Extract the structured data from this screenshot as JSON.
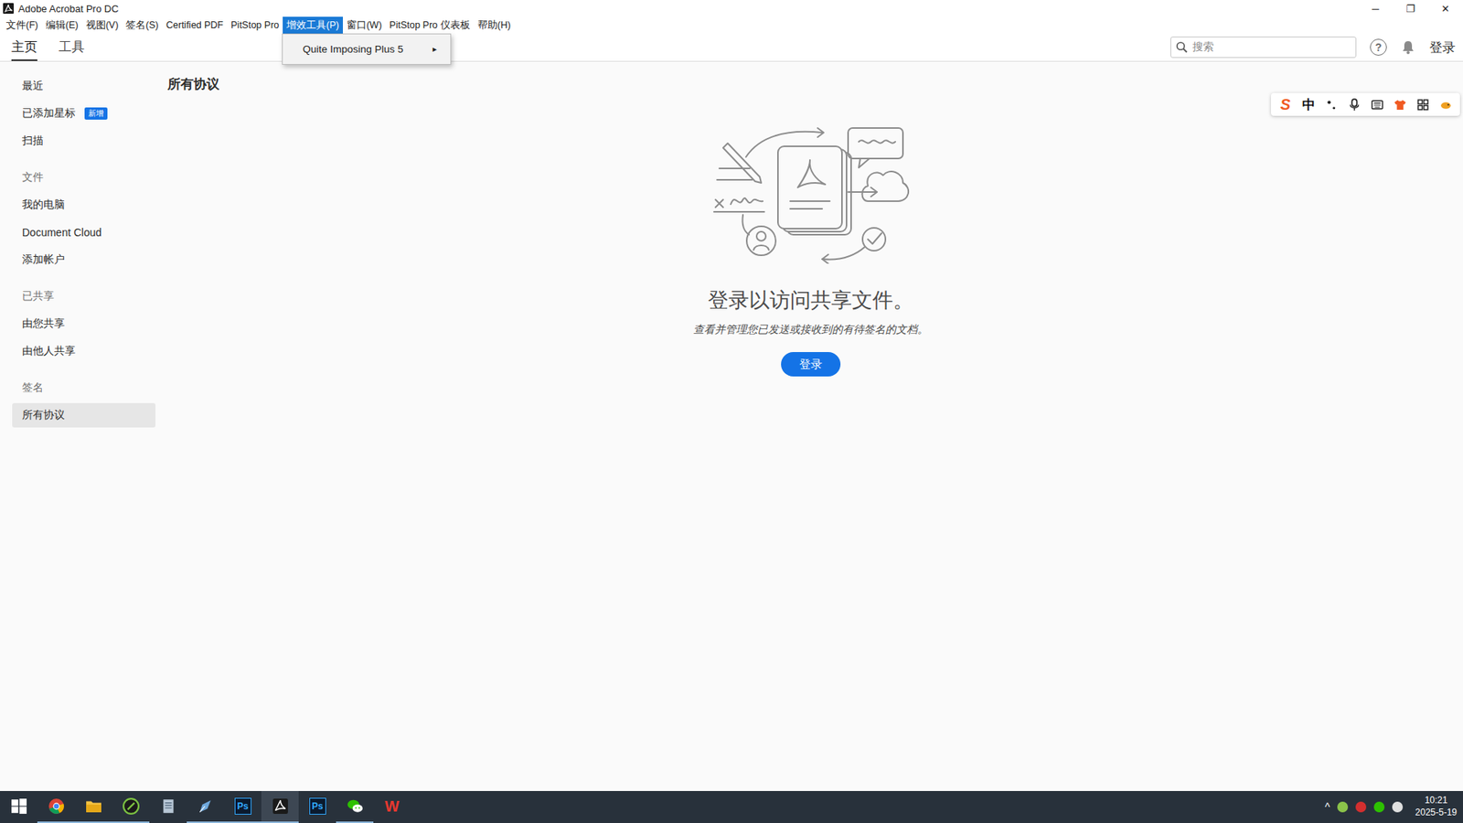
{
  "window": {
    "title": "Adobe Acrobat Pro DC",
    "controls": [
      "─",
      "❐",
      "✕"
    ]
  },
  "menubar": [
    {
      "label": "文件(F)",
      "selected": false
    },
    {
      "label": "编辑(E)",
      "selected": false
    },
    {
      "label": "视图(V)",
      "selected": false
    },
    {
      "label": "签名(S)",
      "selected": false
    },
    {
      "label": "Certified PDF",
      "selected": false
    },
    {
      "label": "PitStop Pro",
      "selected": false
    },
    {
      "label": "增效工具(P)",
      "selected": true
    },
    {
      "label": "窗口(W)",
      "selected": false
    },
    {
      "label": "PitStop Pro 仪表板",
      "selected": false
    },
    {
      "label": "帮助(H)",
      "selected": false
    }
  ],
  "open_menu": {
    "items": [
      {
        "label": "Quite Imposing Plus 5",
        "arrow": "▸"
      }
    ]
  },
  "toolbar": {
    "tabs": [
      {
        "label": "主页",
        "selected": true
      },
      {
        "label": "工具",
        "selected": false
      }
    ],
    "search": {
      "placeholder": "搜索"
    },
    "help": "?",
    "signin": "登录"
  },
  "sidebar": {
    "groups": [
      {
        "items": [
          {
            "label": "最近",
            "selected": false
          },
          {
            "label": "已添加星标",
            "selected": false,
            "badge": "新增"
          },
          {
            "label": "扫描",
            "selected": false
          }
        ]
      },
      {
        "title": "文件",
        "items": [
          {
            "label": "我的电脑",
            "selected": false
          },
          {
            "label": "Document Cloud",
            "selected": false
          },
          {
            "label": "添加帐户",
            "selected": false
          }
        ]
      },
      {
        "title": "已共享",
        "items": [
          {
            "label": "由您共享",
            "selected": false
          },
          {
            "label": "由他人共享",
            "selected": false
          }
        ]
      },
      {
        "title": "签名",
        "items": [
          {
            "label": "所有协议",
            "selected": true
          }
        ]
      }
    ]
  },
  "main": {
    "heading": "所有协议",
    "message": "登录以访问共享文件。",
    "hint": "查看并管理您已发送或接收到的有待签名的文档。",
    "button": "登录"
  },
  "ime_toolbar": [
    {
      "kind": "sogou",
      "label": "S"
    },
    {
      "kind": "text",
      "label": "中"
    },
    {
      "kind": "punct"
    },
    {
      "kind": "mic"
    },
    {
      "kind": "keyboard"
    },
    {
      "kind": "skin"
    },
    {
      "kind": "grid"
    },
    {
      "kind": "more"
    }
  ],
  "taskbar": {
    "apps": [
      {
        "kind": "windows",
        "running": false,
        "active": false
      },
      {
        "kind": "chrome",
        "running": true,
        "active": false
      },
      {
        "kind": "folder",
        "running": true,
        "active": false
      },
      {
        "kind": "corel",
        "running": true,
        "active": false
      },
      {
        "kind": "notepad",
        "running": false,
        "active": false
      },
      {
        "kind": "pen",
        "running": true,
        "active": false
      },
      {
        "kind": "ps",
        "label": "Ps",
        "running": true,
        "active": false
      },
      {
        "kind": "acrobat",
        "running": true,
        "active": true
      },
      {
        "kind": "ps",
        "label": "Ps",
        "running": false,
        "active": false
      },
      {
        "kind": "wechat",
        "running": true,
        "active": false
      },
      {
        "kind": "wps",
        "label": "W",
        "running": false,
        "active": false
      }
    ],
    "tray": {
      "expand": "^",
      "icons": [
        {
          "color": "#8bc34a"
        },
        {
          "color": "#d32f2f"
        },
        {
          "color": "#2dc100"
        },
        {
          "color": "#e0e0e0"
        }
      ],
      "time": "10:21",
      "date": "2025-5-19"
    }
  }
}
